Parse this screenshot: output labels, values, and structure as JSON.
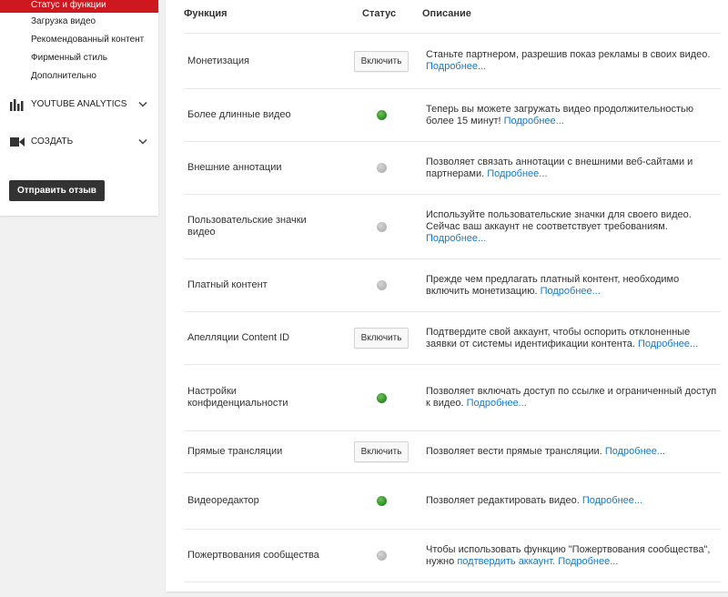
{
  "sidebar": {
    "sub_items": [
      "Статус и функции",
      "Загрузка видео",
      "Рекомендованный контент",
      "Фирменный стиль",
      "Дополнительно"
    ],
    "sections": [
      {
        "label": "YOUTUBE ANALYTICS",
        "icon": "analytics-bars-icon"
      },
      {
        "label": "СОЗДАТЬ",
        "icon": "video-camera-icon"
      }
    ],
    "feedback_label": "Отправить отзыв"
  },
  "table": {
    "headers": {
      "function": "Функция",
      "status": "Статус",
      "description": "Описание"
    },
    "rows": [
      {
        "name": "Монетизация",
        "status": "button",
        "button_label": "Включить",
        "desc": "Станьте партнером, разрешив показ рекламы в своих видео.",
        "desc_after": "",
        "link": "Подробнее...",
        "link_mid": "",
        "desc_pre": ""
      },
      {
        "name": "Более длинные видео",
        "status": "green",
        "desc": "Теперь вы можете загружать видео продолжительностью более 15 минут!",
        "link": "Подробнее..."
      },
      {
        "name": "Внешние аннотации",
        "status": "gray",
        "desc": "Позволяет связать аннотации с внешними веб-сайтами и партнерами.",
        "link": "Подробнее..."
      },
      {
        "name": "Пользовательские значки видео",
        "status": "gray",
        "desc": "Используйте пользовательские значки для своего видео. Сейчас ваш аккаунт не соответствует требованиям.",
        "link": "Подробнее..."
      },
      {
        "name": "Платный контент",
        "status": "gray",
        "desc": "Прежде чем предлагать платный контент, необходимо включить монетизацию.",
        "link": "Подробнее..."
      },
      {
        "name": "Апелляции Content ID",
        "status": "button",
        "button_label": "Включить",
        "desc": "Подтвердите свой аккаунт, чтобы оспорить отклоненные заявки от системы идентификации контента.",
        "link": "Подробнее..."
      },
      {
        "name": "Настройки конфиденциальности",
        "status": "green",
        "desc": "Позволяет включать доступ по ссылке и ограниченный доступ к видео.",
        "link": "Подробнее..."
      },
      {
        "name": "Прямые трансляции",
        "status": "button",
        "button_label": "Включить",
        "desc": "Позволяет вести прямые трансляции.",
        "link": "Подробнее..."
      },
      {
        "name": "Видеоредактор",
        "status": "green",
        "desc": "Позволяет редактировать видео.",
        "link": "Подробнее..."
      },
      {
        "name": "Пожертвования сообщества",
        "status": "gray",
        "desc": "Чтобы использовать функцию \"Пожертвования сообщества\", нужно",
        "link_mid": "подтвердить аккаунт.",
        "link": "Подробнее..."
      }
    ]
  },
  "colors": {
    "accent_red": "#cc181e",
    "link_blue": "#167ac6",
    "status_green": "#2b8a21",
    "status_gray": "#b5b5b5"
  }
}
